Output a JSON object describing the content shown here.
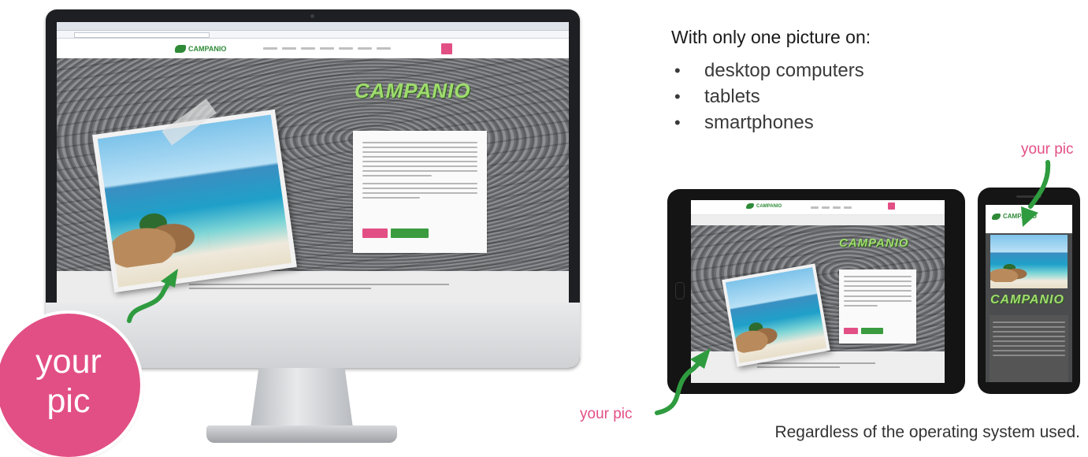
{
  "heading": "With only one picture on:",
  "devices": [
    "desktop computers",
    "tablets",
    "smartphones"
  ],
  "footer_note": "Regardless of the operating system used.",
  "labels": {
    "circle_line1": "your",
    "circle_line2": "pic",
    "tablet_label": "your pic",
    "phone_label": "your pic"
  },
  "site": {
    "logo_text": "CAMPANIO",
    "hero_brand": "CAMPANIO"
  },
  "colors": {
    "accent_pink": "#e24f85",
    "accent_green": "#2e8a37",
    "arrow_green": "#2f9b3f"
  }
}
